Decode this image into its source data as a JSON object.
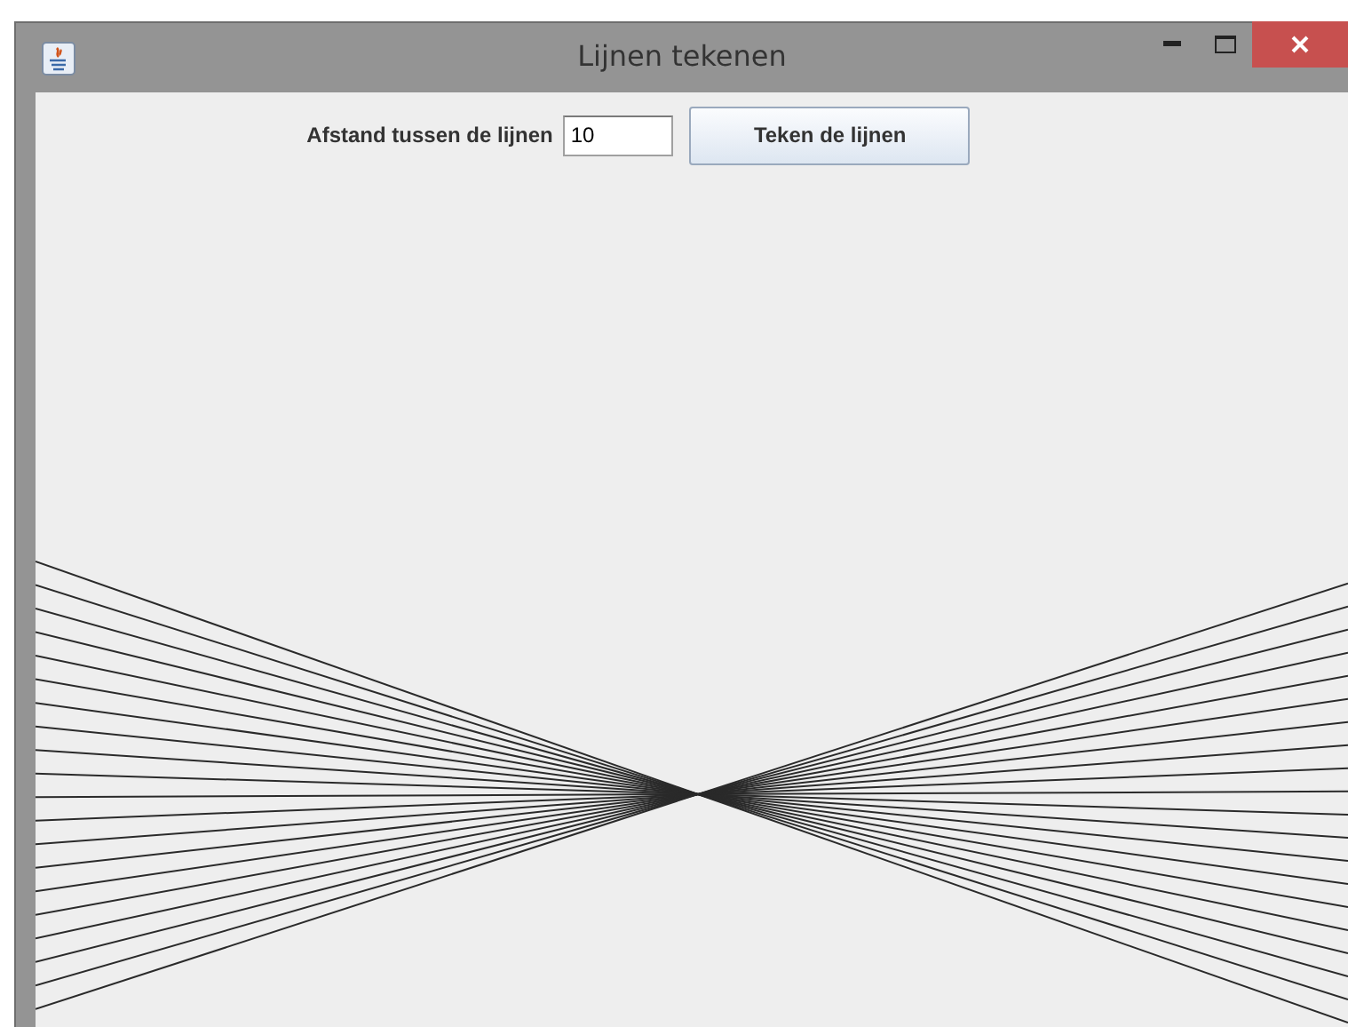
{
  "window": {
    "title": "Lijnen tekenen"
  },
  "toolbar": {
    "label": "Afstand tussen de lijnen",
    "field": {
      "value": "10"
    },
    "button": "Teken de lijnen"
  }
}
